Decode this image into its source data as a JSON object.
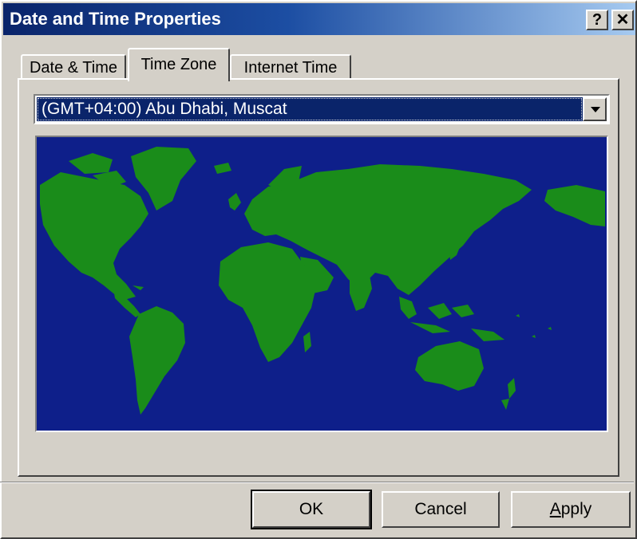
{
  "window": {
    "title": "Date and Time Properties",
    "help_label": "?",
    "close_label": "✕"
  },
  "tabs": [
    {
      "label": "Date & Time",
      "active": false
    },
    {
      "label": "Time Zone",
      "active": true
    },
    {
      "label": "Internet Time",
      "active": false
    }
  ],
  "timezone": {
    "selected": "(GMT+04:00) Abu Dhabi, Muscat"
  },
  "map": {
    "ocean_color": "#0e1f8a",
    "land_color": "#1a8c1a"
  },
  "buttons": {
    "ok": "OK",
    "cancel": "Cancel",
    "apply_first": "A",
    "apply_rest": "pply"
  },
  "icons": {
    "help": "help-icon",
    "close": "close-icon",
    "dropdown": "chevron-down-icon"
  }
}
